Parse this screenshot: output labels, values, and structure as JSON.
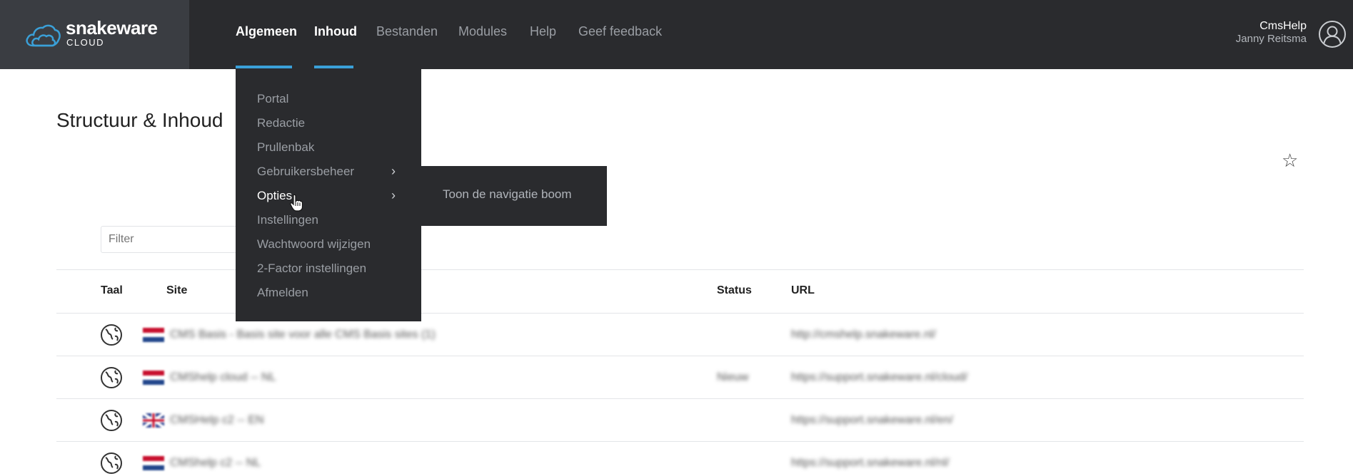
{
  "brand": {
    "name": "snakeware",
    "sub": "CLOUD",
    "accent": "#3aa0d8"
  },
  "nav": {
    "items": [
      "Algemeen",
      "Inhoud",
      "Bestanden",
      "Modules",
      "Help",
      "Geef feedback"
    ],
    "active": [
      "Algemeen",
      "Inhoud"
    ]
  },
  "user": {
    "name": "CmsHelp",
    "fullname": "Janny Reitsma"
  },
  "page": {
    "title": "Structuur & Inhoud"
  },
  "filter": {
    "placeholder": "Filter",
    "value": ""
  },
  "table": {
    "headers": {
      "taal": "Taal",
      "site": "Site",
      "status": "Status",
      "url": "URL"
    },
    "rows": [
      {
        "site": "CMS Basis - Basis site voor alle CMS Basis sites (1)",
        "status": "",
        "url": "http://cmshelp.snakeware.nl/"
      },
      {
        "site": "CMShelp cloud -- NL",
        "status": "Nieuw",
        "url": "https://support.snakeware.nl/cloud/"
      },
      {
        "site": "CMSHelp c2 -- EN",
        "status": "",
        "url": "https://support.snakeware.nl/en/"
      },
      {
        "site": "CMShelp c2 -- NL",
        "status": "",
        "url": "https://support.snakeware.nl/nl/"
      }
    ]
  },
  "dropdown": {
    "items": [
      "Portal",
      "Redactie",
      "Prullenbak",
      "Gebruikersbeheer",
      "Opties",
      "Instellingen",
      "Wachtwoord wijzigen",
      "2-Factor instellingen",
      "Afmelden"
    ],
    "highlighted": "Opties",
    "submenu": {
      "items": [
        "Toon de navigatie boom"
      ]
    }
  },
  "icons": {
    "star": "star-icon",
    "globe": "globe-icon",
    "avatar": "user-icon",
    "chevron": "chevron-right-icon"
  }
}
